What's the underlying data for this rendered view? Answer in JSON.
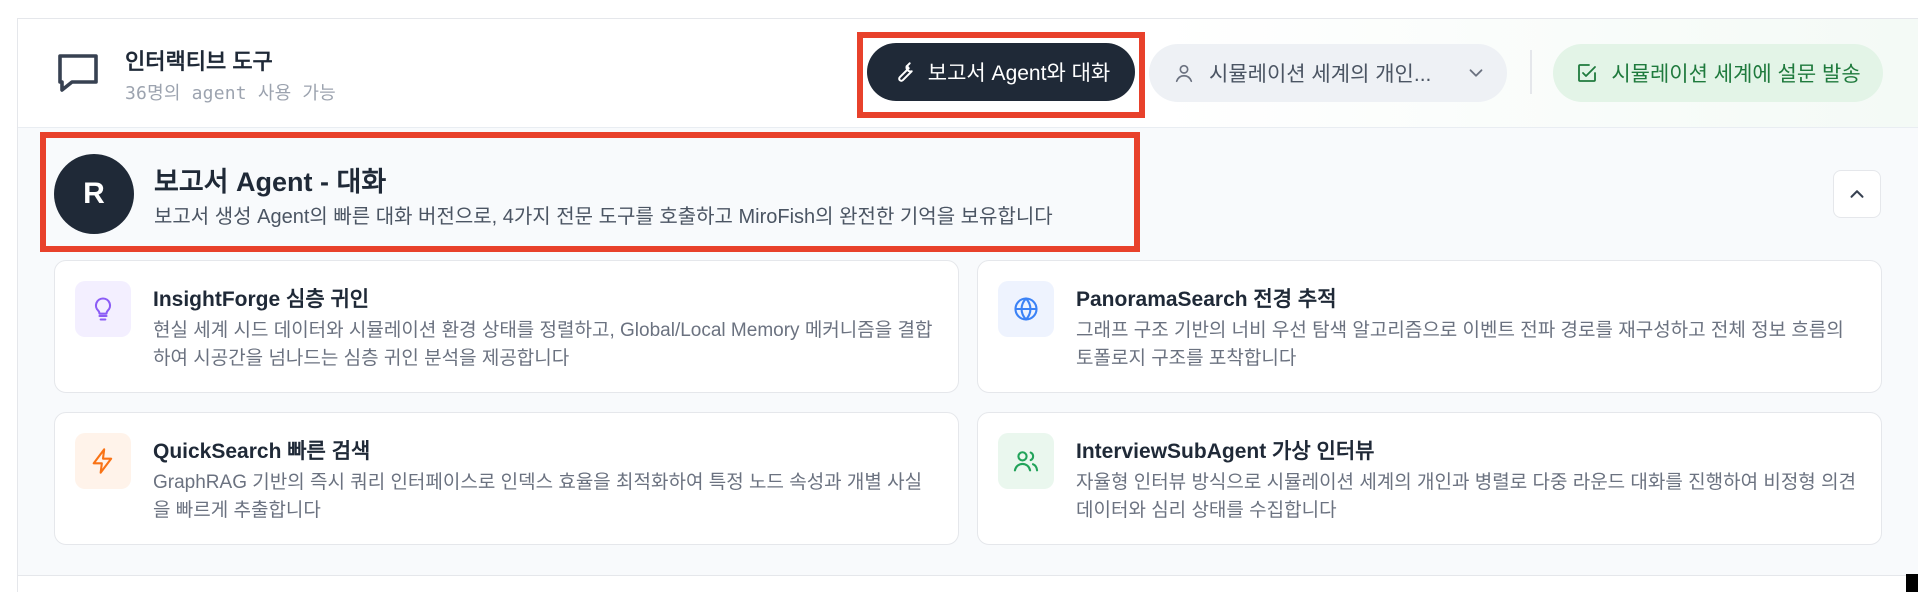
{
  "header": {
    "title": "인터랙티브 도구",
    "subtitle": "36명의 agent 사용 가능",
    "report_button_label": "보고서 Agent와 대화",
    "select_value": "시뮬레이션 세계의 개인...",
    "survey_button_label": "시뮬레이션 세계에 설문 발송",
    "icons": {
      "chat": "chat-bubble-icon",
      "report": "wrench-icon",
      "select": "user-icon",
      "dropdown": "chevron-down-icon",
      "survey": "checkbox-edit-icon"
    }
  },
  "agent": {
    "avatar_letter": "R",
    "title": "보고서 Agent - 대화",
    "description": "보고서 생성 Agent의 빠른 대화 버전으로, 4가지 전문 도구를 호출하고 MiroFish의 완전한 기억을 보유합니다"
  },
  "tools": [
    {
      "title": "InsightForge 심층 귀인",
      "description": "현실 세계 시드 데이터와 시뮬레이션 환경 상태를 정렬하고, Global/Local Memory 메커니즘을 결합하여 시공간을 넘나드는 심층 귀인 분석을 제공합니다",
      "icon": "lightbulb-icon",
      "color": "#8b5cf6",
      "bg": "#f3efff"
    },
    {
      "title": "PanoramaSearch 전경 추적",
      "description": "그래프 구조 기반의 너비 우선 탐색 알고리즘으로 이벤트 전파 경로를 재구성하고 전체 정보 흐름의 토폴로지 구조를 포착합니다",
      "icon": "globe-icon",
      "color": "#3b82f6",
      "bg": "#eef3fe"
    },
    {
      "title": "QuickSearch 빠른 검색",
      "description": "GraphRAG 기반의 즉시 쿼리 인터페이스로 인덱스 효율을 최적화하여 특정 노드 속성과 개별 사실을 빠르게 추출합니다",
      "icon": "lightning-icon",
      "color": "#f97316",
      "bg": "#fff3ea"
    },
    {
      "title": "InterviewSubAgent 가상 인터뷰",
      "description": "자율형 인터뷰 방식으로 시뮬레이션 세계의 개인과 병렬로 다중 라운드 대화를 진행하여 비정형 의견 데이터와 심리 상태를 수집합니다",
      "icon": "users-icon",
      "color": "#22a35a",
      "bg": "#eaf7ee"
    }
  ]
}
